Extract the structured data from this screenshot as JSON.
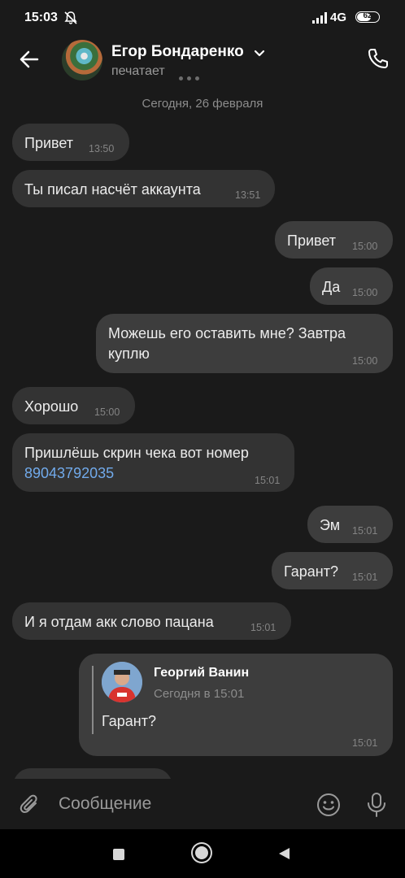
{
  "status_bar": {
    "time": "15:03",
    "network": "4G",
    "battery": "62"
  },
  "header": {
    "name": "Егор Бондаренко",
    "status": "печатает"
  },
  "date_separator": "Сегодня, 26 февраля",
  "messages": [
    {
      "text": "Привет",
      "time": "13:50",
      "direction": "incoming"
    },
    {
      "text": "Ты писал насчёт аккаунта",
      "time": "13:51",
      "direction": "incoming"
    },
    {
      "text": "Привет",
      "time": "15:00",
      "direction": "outgoing"
    },
    {
      "text": "Да",
      "time": "15:00",
      "direction": "outgoing"
    },
    {
      "line1": "Можешь его оставить мне? Завтра",
      "line2": "куплю",
      "time": "15:00",
      "direction": "outgoing"
    },
    {
      "text": "Хорошо",
      "time": "15:00",
      "direction": "incoming"
    },
    {
      "line1": "Пришлёшь скрин чека вот номер",
      "link": "89043792035",
      "time": "15:01",
      "direction": "incoming"
    },
    {
      "text": "Эм",
      "time": "15:01",
      "direction": "outgoing"
    },
    {
      "text": "Гарант?",
      "time": "15:01",
      "direction": "outgoing"
    },
    {
      "text": "И я отдам акк слово пацана",
      "time": "15:01",
      "direction": "incoming"
    },
    {
      "reply_name": "Георгий Ванин",
      "reply_time": "Сегодня в 15:01",
      "text": "Гарант?",
      "time": "15:01",
      "direction": "outgoing"
    }
  ],
  "composer": {
    "placeholder": "Сообщение"
  },
  "colors": {
    "background": "#1a1a1a",
    "bubble_in": "#333333",
    "bubble_out": "#3d3d3d",
    "link": "#71aaeb"
  }
}
